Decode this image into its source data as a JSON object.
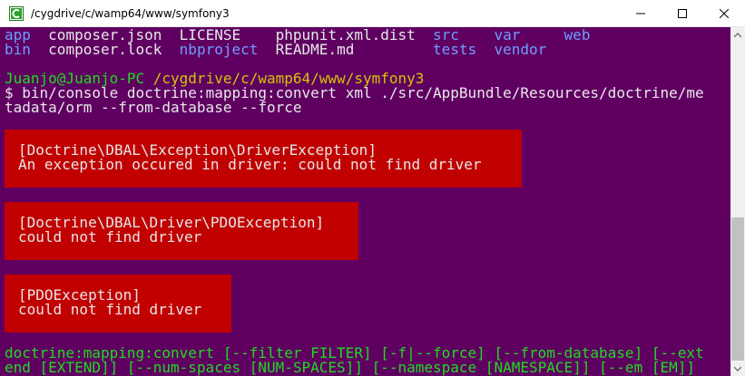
{
  "window": {
    "title": "/cygdrive/c/wamp64/www/symfony3",
    "icon": "cygwin-terminal-icon",
    "controls": {
      "minimize": "minimize-icon",
      "maximize": "maximize-icon",
      "close": "close-icon"
    }
  },
  "ls_output": {
    "row1": [
      {
        "text": "app",
        "type": "dir"
      },
      {
        "text": "composer.json",
        "type": "file"
      },
      {
        "text": "LICENSE",
        "type": "file"
      },
      {
        "text": "phpunit.xml.dist",
        "type": "file"
      },
      {
        "text": "src",
        "type": "dir"
      },
      {
        "text": "var",
        "type": "dir"
      },
      {
        "text": "web",
        "type": "dir"
      }
    ],
    "row2": [
      {
        "text": "bin",
        "type": "dir"
      },
      {
        "text": "composer.lock",
        "type": "file"
      },
      {
        "text": "nbproject",
        "type": "dir"
      },
      {
        "text": "README.md",
        "type": "file"
      },
      {
        "text": "tests",
        "type": "dir"
      },
      {
        "text": "vendor",
        "type": "dir"
      }
    ]
  },
  "prompt": {
    "user_host": "Juanjo@Juanjo-PC",
    "path": "/cygdrive/c/wamp64/www/symfony3",
    "symbol": "$",
    "command_line1": "bin/console doctrine:mapping:convert xml ./src/AppBundle/Resources/doctrine/me",
    "command_line2": "tadata/orm --from-database --force"
  },
  "errors": [
    {
      "type": "[Doctrine\\DBAL\\Exception\\DriverException]",
      "message": "An exception occured in driver: could not find driver"
    },
    {
      "type": "[Doctrine\\DBAL\\Driver\\PDOException]",
      "message": "could not find driver"
    },
    {
      "type": "[PDOException]",
      "message": "could not find driver"
    }
  ],
  "usage": {
    "line1": "doctrine:mapping:convert [--filter FILTER] [-f|--force] [--from-database] [--ext",
    "line2": "end [EXTEND]] [--num-spaces [NUM-SPACES]] [--namespace [NAMESPACE]] [--em [EM]]"
  },
  "colors": {
    "background": "#5f0061",
    "error_background": "#c10000",
    "directory": "#6f9dff",
    "prompt_green": "#1edc1e",
    "prompt_path": "#d6c20a"
  }
}
